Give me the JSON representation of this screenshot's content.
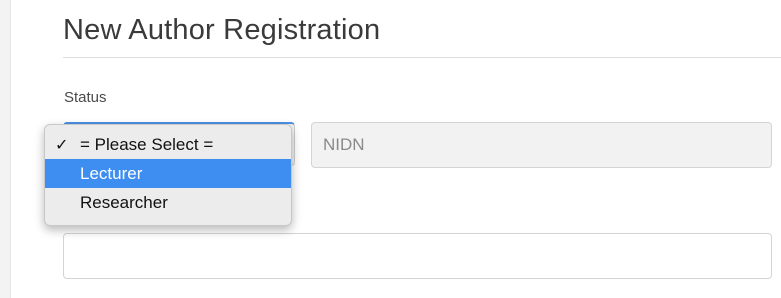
{
  "form": {
    "title": "New Author Registration",
    "status_label": "Status",
    "nidn_placeholder": "NIDN",
    "status_select": {
      "selected": "= Please Select =",
      "options": [
        {
          "label": "= Please Select =",
          "checked": true,
          "highlighted": false
        },
        {
          "label": "Lecturer",
          "checked": false,
          "highlighted": true
        },
        {
          "label": "Researcher",
          "checked": false,
          "highlighted": false
        }
      ]
    },
    "second_field_value": ""
  },
  "icons": {
    "check": "checkmark-icon"
  },
  "colors": {
    "highlight": "#3d8ef0",
    "focus_border": "#4a90e2",
    "title_text": "#3a3a3a"
  }
}
